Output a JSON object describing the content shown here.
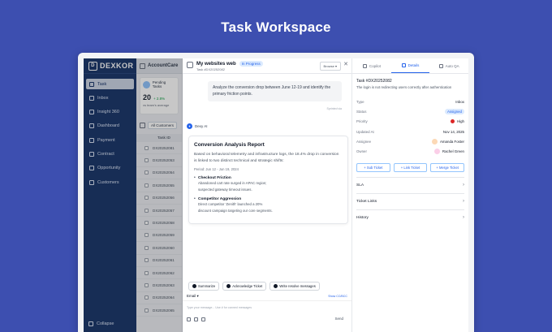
{
  "page_title": "Task Workspace",
  "sidebar": {
    "brand": "DEXKOR",
    "items": [
      {
        "label": "Task",
        "icon": "task-icon",
        "active": true
      },
      {
        "label": "Inbox",
        "icon": "inbox-icon"
      },
      {
        "label": "Insight 360",
        "icon": "insight-icon"
      },
      {
        "label": "Dashboard",
        "icon": "dashboard-icon"
      },
      {
        "label": "Payment",
        "icon": "payment-icon"
      },
      {
        "label": "Contract",
        "icon": "contract-icon"
      },
      {
        "label": "Opportunity",
        "icon": "opportunity-icon"
      },
      {
        "label": "Customers",
        "icon": "customers-icon"
      }
    ],
    "collapse": "Collapse"
  },
  "list": {
    "header": "AccountCare",
    "pending_title": "Pending Tasks",
    "pending_count": "20",
    "pending_delta": "+ 2.8%",
    "pending_sub": "vs team's average",
    "filter": "All Customers",
    "col_header": "Task ID",
    "tickets": [
      "DX20252081",
      "DX20252053",
      "DX20252054",
      "DX20252055",
      "DX20252056",
      "DX20252057",
      "DX20252058",
      "DX20252059",
      "DX20252060",
      "DX20252061",
      "DX20252062",
      "DX20252063",
      "DX20252064",
      "DX20252065"
    ]
  },
  "chat": {
    "title": "My websites web",
    "status": "In Progress",
    "subtitle": "Task #DX20252082",
    "browse": "Browse",
    "user_message": "Analyze the conversion drop between June 12-19 and identify the primary friction points.",
    "user_meta": "Sprinted via",
    "ai_name": "Dexy AI",
    "report": {
      "title": "Conversion Analysis Report",
      "summary": "Based on behavioral telemetry and infrastructure logs, the 18.4% drop in conversion is linked to two distinct technical and strategic shifts:",
      "period": "Period: Jun 12 - Jun 19, 2024",
      "findings": [
        {
          "title": "Checkout Friction",
          "text_1": "Abandoned cart rate surged in APAC region;",
          "text_2": "suspected gateway timeout issues."
        },
        {
          "title": "Competitor Aggression",
          "text_1": "Direct competitor 'Zenith' launched a 20%",
          "text_2": "discount campaign targeting our core segments."
        }
      ]
    },
    "actions": [
      "Summarize",
      "Acknowledge Ticket",
      "Write resolve messages"
    ],
    "channel": "Email",
    "show_cc": "Show CC/BCC",
    "placeholder": "Type your message... Use # for canned messages",
    "send": "Send"
  },
  "details": {
    "tabs": [
      "Copilot",
      "Details",
      "Auto QA"
    ],
    "active_tab": 1,
    "task_id": "Task #DX20252082",
    "description": "The login is not redirecting users correctly after authentication",
    "props": [
      {
        "key": "Type",
        "value": "Inbox"
      },
      {
        "key": "Status",
        "value": "Assigned"
      },
      {
        "key": "Priority",
        "value": "High"
      },
      {
        "key": "Updated At",
        "value": "Nov 14, 2025"
      },
      {
        "key": "Assignee",
        "value": "Amanda Foster"
      },
      {
        "key": "Owner",
        "value": "Rachel Green"
      }
    ],
    "actions": [
      "+ Sub Ticket",
      "+ Link Ticket",
      "+ Merge Ticket"
    ],
    "sections": [
      "SLA",
      "Ticket Links",
      "History"
    ]
  },
  "colors": {
    "background": "#3d4fb0",
    "sidebar": "#1e3a6e",
    "accent": "#2563eb",
    "priority_high": "#dc2626"
  }
}
